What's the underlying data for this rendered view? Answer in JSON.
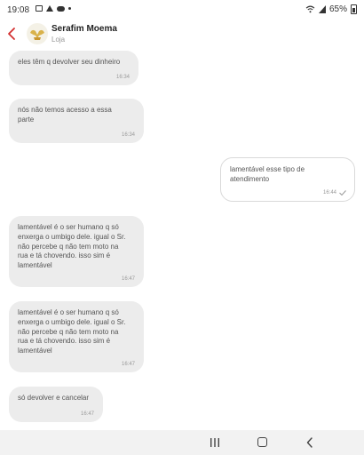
{
  "status_bar": {
    "time": "19:08",
    "battery": "65%"
  },
  "header": {
    "contact_name": "Serafim Moema",
    "contact_subtitle": "Loja"
  },
  "messages": [
    {
      "direction": "in",
      "text": "eles têm q devolver seu dinheiro",
      "time": "16:34"
    },
    {
      "direction": "in",
      "text": "nós não temos acesso a essa\nparte",
      "time": "16:34"
    },
    {
      "direction": "out",
      "text": "lamentável esse tipo de\natendimento",
      "time": "16:44",
      "status": "sent"
    },
    {
      "direction": "in",
      "text": "lamentável é o ser humano q só\nenxerga o umbigo dele. igual o Sr.\nnão percebe q não tem moto na\nrua e tá chovendo. isso sim é\nlamentável",
      "time": "16:47"
    },
    {
      "direction": "in",
      "text": "lamentável é o ser humano q só\nenxerga o umbigo dele. igual o Sr.\nnão percebe q não tem moto na\nrua e tá chovendo. isso sim é\nlamentável",
      "time": "16:47"
    },
    {
      "direction": "in",
      "text": "só devolver e cancelar",
      "time": "16:47"
    }
  ],
  "colors": {
    "accent": "#d32f2f",
    "incoming_bubble": "#ececec",
    "outgoing_border": "#d9d9d9"
  }
}
